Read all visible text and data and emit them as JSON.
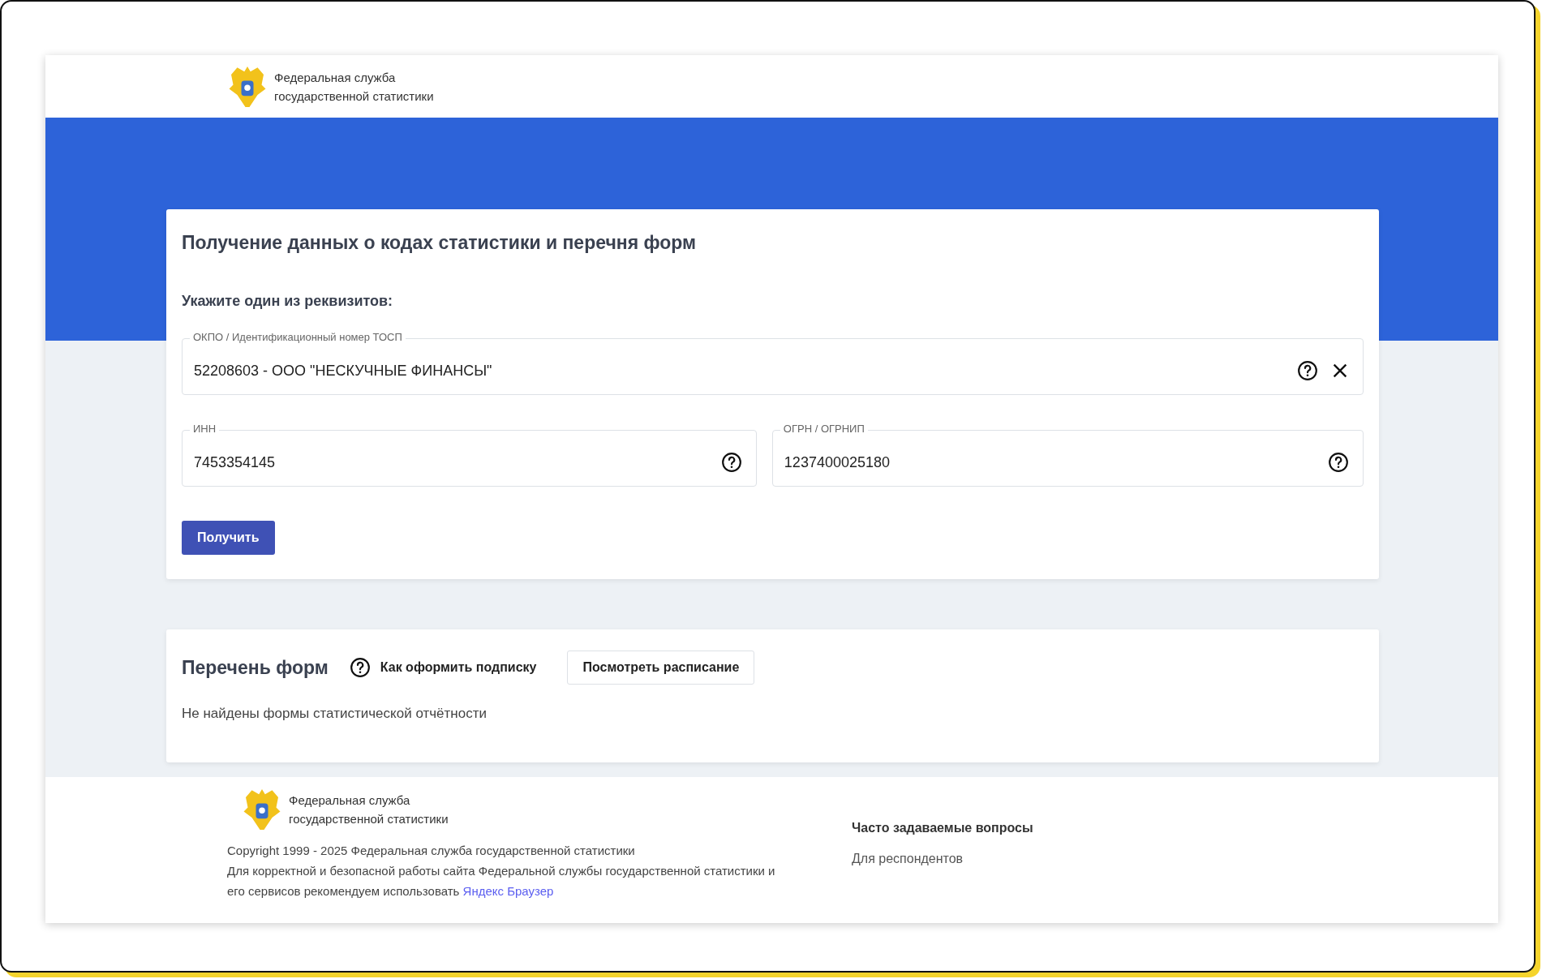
{
  "header": {
    "logo_text": "Федеральная служба\nгосударственной статистики"
  },
  "request_card": {
    "title": "Получение данных о кодах статистики и перечня форм",
    "subtitle": "Укажите один из реквизитов:",
    "fields": [
      {
        "label": "ОКПО / Идентификационный номер ТОСП",
        "value": "52208603 - ООО \"НЕСКУЧНЫЕ ФИНАНСЫ\"",
        "clearable": true
      },
      {
        "label": "ИНН",
        "value": "7453354145",
        "clearable": false
      },
      {
        "label": "ОГРН / ОГРНИП",
        "value": "1237400025180",
        "clearable": false
      }
    ],
    "submit_button": "Получить"
  },
  "forms_card": {
    "title": "Перечень форм",
    "subscribe_link": "Как оформить подписку",
    "schedule_button": "Посмотреть расписание",
    "empty_message": "Не найдены формы статистической отчётности"
  },
  "footer": {
    "logo_text": "Федеральная служба\nгосударственной статистики",
    "copyright": "Copyright 1999 - 2025 Федеральная служба государственной статистики",
    "notice": "Для корректной и безопасной работы сайта Федеральной службы государственной статистики и его сервисов рекомендуем использовать",
    "notice_link": "Яндекс Браузер",
    "links_title": "Часто задаваемые вопросы",
    "links": [
      "Для респондентов"
    ]
  }
}
